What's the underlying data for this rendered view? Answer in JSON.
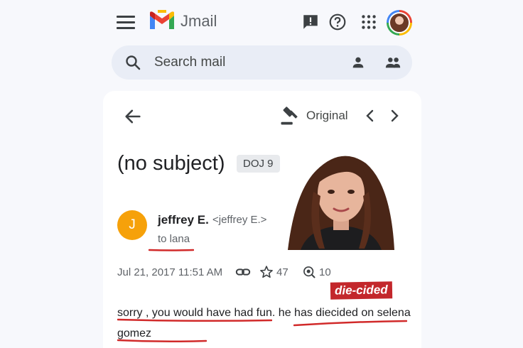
{
  "app": {
    "name": "Jmail"
  },
  "search": {
    "placeholder": "Search mail"
  },
  "email": {
    "original_label": "Original",
    "subject": "(no subject)",
    "label": "DOJ 9",
    "sender": {
      "initial": "J",
      "name": "jeffrey E.",
      "email": "<jeffrey E.>"
    },
    "recipient": "to lana",
    "date": "Jul 21, 2017 11:51 AM",
    "stars": "47",
    "views": "10",
    "stamp": "die-cided",
    "body": "sorry , you would have had fun. he has diecided on selena gomez"
  },
  "colors": {
    "accent_red": "#c3272b",
    "sender_avatar": "#f6a10a",
    "search_bg": "#e9edf6"
  }
}
